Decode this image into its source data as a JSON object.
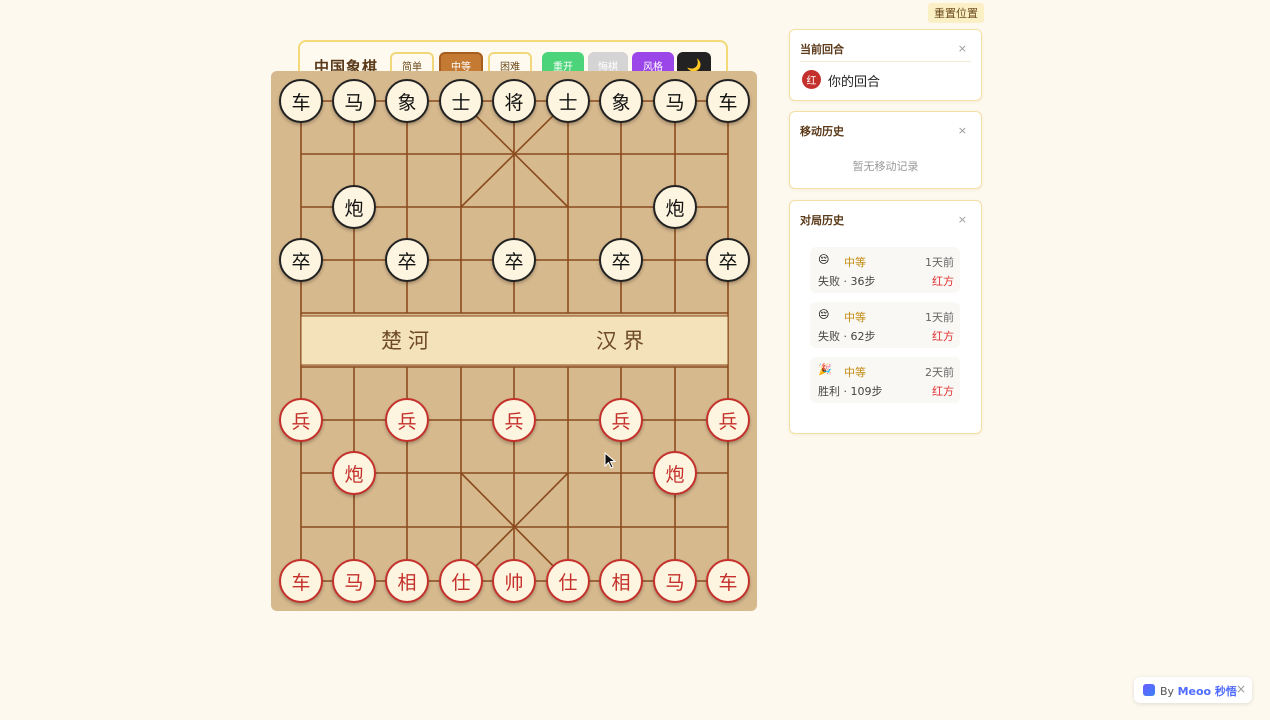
{
  "reset_position_label": "重置位置",
  "toolbar": {
    "title": "中国象棋",
    "easy": "简单",
    "medium": "中等",
    "hard": "困难",
    "restart": "重开",
    "undo": "悔棋",
    "style": "风格",
    "dark_icon": "🌙"
  },
  "board": {
    "river_left": "楚河",
    "river_right": "汉界"
  },
  "pieces": [
    {
      "c": "车",
      "side": "black",
      "col": 0,
      "row": 0
    },
    {
      "c": "马",
      "side": "black",
      "col": 1,
      "row": 0
    },
    {
      "c": "象",
      "side": "black",
      "col": 2,
      "row": 0
    },
    {
      "c": "士",
      "side": "black",
      "col": 3,
      "row": 0
    },
    {
      "c": "将",
      "side": "black",
      "col": 4,
      "row": 0
    },
    {
      "c": "士",
      "side": "black",
      "col": 5,
      "row": 0
    },
    {
      "c": "象",
      "side": "black",
      "col": 6,
      "row": 0
    },
    {
      "c": "马",
      "side": "black",
      "col": 7,
      "row": 0
    },
    {
      "c": "车",
      "side": "black",
      "col": 8,
      "row": 0
    },
    {
      "c": "炮",
      "side": "black",
      "col": 1,
      "row": 2
    },
    {
      "c": "炮",
      "side": "black",
      "col": 7,
      "row": 2
    },
    {
      "c": "卒",
      "side": "black",
      "col": 0,
      "row": 3
    },
    {
      "c": "卒",
      "side": "black",
      "col": 2,
      "row": 3
    },
    {
      "c": "卒",
      "side": "black",
      "col": 4,
      "row": 3
    },
    {
      "c": "卒",
      "side": "black",
      "col": 6,
      "row": 3
    },
    {
      "c": "卒",
      "side": "black",
      "col": 8,
      "row": 3
    },
    {
      "c": "兵",
      "side": "red",
      "col": 0,
      "row": 6
    },
    {
      "c": "兵",
      "side": "red",
      "col": 2,
      "row": 6
    },
    {
      "c": "兵",
      "side": "red",
      "col": 4,
      "row": 6
    },
    {
      "c": "兵",
      "side": "red",
      "col": 6,
      "row": 6
    },
    {
      "c": "兵",
      "side": "red",
      "col": 8,
      "row": 6
    },
    {
      "c": "炮",
      "side": "red",
      "col": 1,
      "row": 7
    },
    {
      "c": "炮",
      "side": "red",
      "col": 7,
      "row": 7
    },
    {
      "c": "车",
      "side": "red",
      "col": 0,
      "row": 9
    },
    {
      "c": "马",
      "side": "red",
      "col": 1,
      "row": 9
    },
    {
      "c": "相",
      "side": "red",
      "col": 2,
      "row": 9
    },
    {
      "c": "仕",
      "side": "red",
      "col": 3,
      "row": 9
    },
    {
      "c": "帅",
      "side": "red",
      "col": 4,
      "row": 9
    },
    {
      "c": "仕",
      "side": "red",
      "col": 5,
      "row": 9
    },
    {
      "c": "相",
      "side": "red",
      "col": 6,
      "row": 9
    },
    {
      "c": "马",
      "side": "red",
      "col": 7,
      "row": 9
    },
    {
      "c": "车",
      "side": "red",
      "col": 8,
      "row": 9
    }
  ],
  "current_turn": {
    "title": "当前回合",
    "close": "×",
    "badge": "红",
    "text": "你的回合"
  },
  "move_history": {
    "title": "移动历史",
    "close": "×",
    "empty": "暂无移动记录"
  },
  "game_history": {
    "title": "对局历史",
    "close": "×",
    "items": [
      {
        "emoji": "😔",
        "level": "中等",
        "time": "1天前",
        "result": "失败 · 36步",
        "side": "红方"
      },
      {
        "emoji": "😔",
        "level": "中等",
        "time": "1天前",
        "result": "失败 · 62步",
        "side": "红方"
      },
      {
        "emoji": "🎉",
        "level": "中等",
        "time": "2天前",
        "result": "胜利 · 109步",
        "side": "红方"
      }
    ]
  },
  "meoo": {
    "by": "By ",
    "brand": "Meoo 秒悟",
    "close": "×"
  }
}
